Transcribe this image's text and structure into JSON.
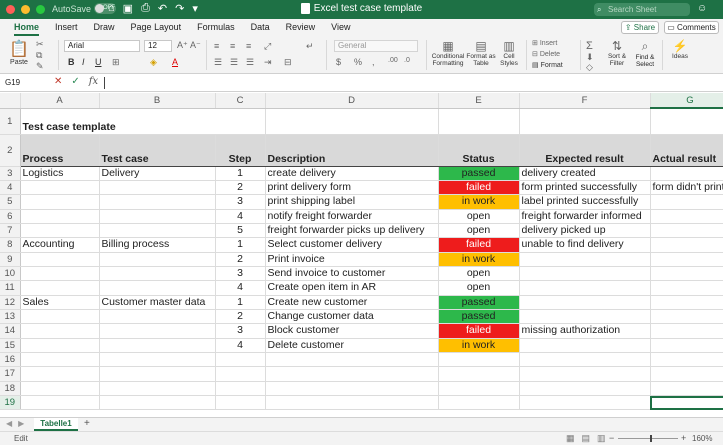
{
  "window": {
    "title": "Excel test case template",
    "autosave_label": "AutoSave",
    "autosave_state": "OFF",
    "search_placeholder": "Search Sheet"
  },
  "ribbon": {
    "tabs": [
      "Home",
      "Insert",
      "Draw",
      "Page Layout",
      "Formulas",
      "Data",
      "Review",
      "View"
    ],
    "active_tab": "Home",
    "share_label": "Share",
    "comments_label": "Comments",
    "paste_label": "Paste",
    "font_name": "Arial",
    "font_size": "12",
    "number_format": "General",
    "cond_format_label": "Conditional Formatting",
    "format_table_label": "Format as Table",
    "cell_styles_label": "Cell Styles",
    "insert_label": "Insert",
    "delete_label": "Delete",
    "format_label": "Format",
    "sort_filter_label": "Sort & Filter",
    "find_select_label": "Find & Select",
    "ideas_label": "Ideas"
  },
  "formula_bar": {
    "name_box": "G19",
    "formula": ""
  },
  "columns": [
    "A",
    "B",
    "C",
    "D",
    "E",
    "F",
    "G"
  ],
  "selected_column": "G",
  "selected_row": "19",
  "rows": {
    "title": "Test case template",
    "headers": [
      "Process",
      "Test case",
      "Step",
      "Description",
      "Status",
      "Expected result",
      "Actual result"
    ],
    "data": [
      {
        "row": "3",
        "process": "Logistics",
        "testcase": "Delivery",
        "step": "1",
        "desc": "create delivery",
        "status": "passed",
        "expected": "delivery created",
        "actual": ""
      },
      {
        "row": "4",
        "process": "",
        "testcase": "",
        "step": "2",
        "desc": "print delivery form",
        "status": "failed",
        "expected": "form printed successfully",
        "actual": "form didn't print"
      },
      {
        "row": "5",
        "process": "",
        "testcase": "",
        "step": "3",
        "desc": "print shipping label",
        "status": "in work",
        "expected": "label printed successfully",
        "actual": ""
      },
      {
        "row": "6",
        "process": "",
        "testcase": "",
        "step": "4",
        "desc": "notify freight forwarder",
        "status": "open",
        "expected": "freight forwarder informed",
        "actual": ""
      },
      {
        "row": "7",
        "process": "",
        "testcase": "",
        "step": "5",
        "desc": "freight forwarder picks up delivery",
        "status": "open",
        "expected": "delivery picked up",
        "actual": ""
      },
      {
        "row": "8",
        "process": "Accounting",
        "testcase": "Billing process",
        "step": "1",
        "desc": "Select customer delivery",
        "status": "failed",
        "expected": "unable to find delivery",
        "actual": ""
      },
      {
        "row": "9",
        "process": "",
        "testcase": "",
        "step": "2",
        "desc": "Print invoice",
        "status": "in work",
        "expected": "",
        "actual": ""
      },
      {
        "row": "10",
        "process": "",
        "testcase": "",
        "step": "3",
        "desc": "Send invoice to customer",
        "status": "open",
        "expected": "",
        "actual": ""
      },
      {
        "row": "11",
        "process": "",
        "testcase": "",
        "step": "4",
        "desc": "Create open item in AR",
        "status": "open",
        "expected": "",
        "actual": ""
      },
      {
        "row": "12",
        "process": "Sales",
        "testcase": "Customer master data",
        "step": "1",
        "desc": "Create new customer",
        "status": "passed",
        "expected": "",
        "actual": ""
      },
      {
        "row": "13",
        "process": "",
        "testcase": "",
        "step": "2",
        "desc": "Change customer data",
        "status": "passed",
        "expected": "",
        "actual": ""
      },
      {
        "row": "14",
        "process": "",
        "testcase": "",
        "step": "3",
        "desc": "Block customer",
        "status": "failed",
        "expected": "missing authorization",
        "actual": ""
      },
      {
        "row": "15",
        "process": "",
        "testcase": "",
        "step": "4",
        "desc": "Delete customer",
        "status": "in work",
        "expected": "",
        "actual": ""
      },
      {
        "row": "16",
        "process": "",
        "testcase": "",
        "step": "",
        "desc": "",
        "status": "",
        "expected": "",
        "actual": ""
      },
      {
        "row": "17",
        "process": "",
        "testcase": "",
        "step": "",
        "desc": "",
        "status": "",
        "expected": "",
        "actual": ""
      },
      {
        "row": "18",
        "process": "",
        "testcase": "",
        "step": "",
        "desc": "",
        "status": "",
        "expected": "",
        "actual": ""
      },
      {
        "row": "19",
        "process": "",
        "testcase": "",
        "step": "",
        "desc": "",
        "status": "",
        "expected": "",
        "actual": ""
      }
    ]
  },
  "status_colors": {
    "passed": "#2db84b",
    "failed": "#ee1c1c",
    "in work": "#ffbf00",
    "open": "#ffffff"
  },
  "sheets": {
    "active": "Tabelle1"
  },
  "statusbar": {
    "mode": "Edit",
    "zoom": "160%"
  }
}
